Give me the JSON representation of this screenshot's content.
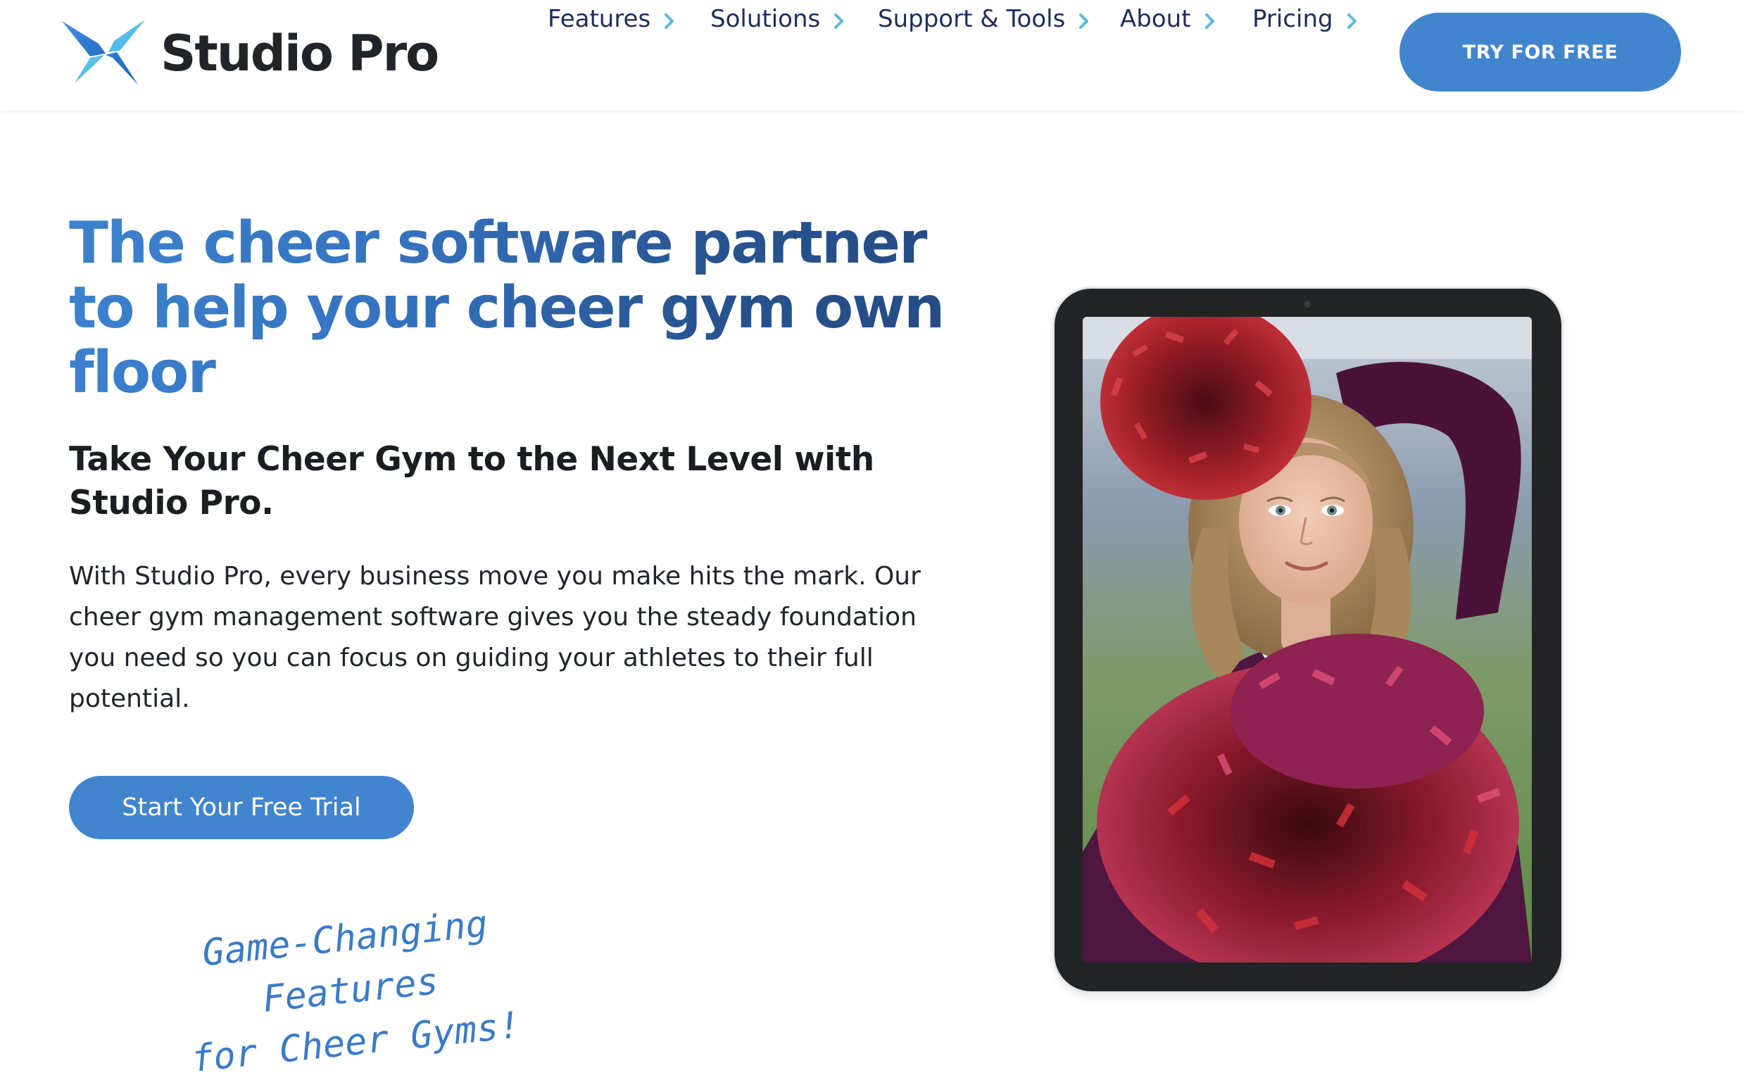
{
  "header": {
    "logo_text": "Studio Pro",
    "nav": [
      {
        "label": "Features"
      },
      {
        "label": "Solutions"
      },
      {
        "label": "Support & Tools"
      },
      {
        "label": "About"
      },
      {
        "label": "Pricing"
      }
    ],
    "try_button_label": "TRY FOR FREE"
  },
  "hero": {
    "title": "The cheer software partner to help your cheer gym own floor",
    "subtitle": "Take Your Cheer Gym to the Next Level with Studio Pro.",
    "body": "With Studio Pro, every business move you make hits the mark. Our cheer gym management software gives you the steady foundation you need so you can focus on guiding your athletes to their full potential.",
    "cta_label": "Start Your Free Trial"
  },
  "features_heading": {
    "line1": "Game-Changing Features",
    "line2": "for Cheer Gyms!"
  },
  "colors": {
    "accent_blue": "#4185cf",
    "nav_text": "#1f2d5c",
    "chevron": "#5bb8e0",
    "heading_dark_blue": "#244a84"
  },
  "icons": {
    "logo": "studio-pro-x-logo",
    "nav_chevron": "chevron-right-icon"
  }
}
